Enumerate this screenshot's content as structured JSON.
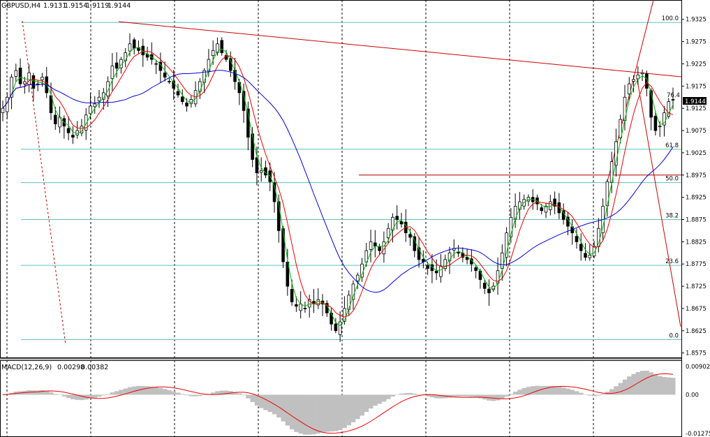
{
  "header": {
    "symbol": "GBPUSD,H4",
    "open": "1.9131",
    "high": "1.9154",
    "low": "1.9119",
    "close": "1.9144"
  },
  "macd_header": {
    "label": "MACD(12,26,9)",
    "main": "0.00298",
    "signal": "0.00382"
  },
  "price_axis": {
    "ticks": [
      "1.9325",
      "1.9275",
      "1.9225",
      "1.9175",
      "1.9125",
      "1.9075",
      "1.9025",
      "1.8975",
      "1.8925",
      "1.8875",
      "1.8825",
      "1.8775",
      "1.8725",
      "1.8675",
      "1.8625",
      "1.8575"
    ],
    "current_price": "1.9144",
    "range": [
      1.8565,
      1.9345
    ]
  },
  "macd_axis": {
    "ticks": [
      "0.00902",
      "0.00",
      "-0.01275"
    ],
    "range": [
      -0.0133,
      0.0106
    ]
  },
  "fibonacci": {
    "levels": [
      {
        "label": "100.0",
        "price": 1.9318
      },
      {
        "label": "61.8",
        "price": 1.9033
      },
      {
        "label": "50.0",
        "price": 1.8958
      },
      {
        "label": "38.2",
        "price": 1.8875
      },
      {
        "label": "23.6",
        "price": 1.8772
      },
      {
        "label": "0.0",
        "price": 1.8605
      }
    ],
    "line_color": "#5fbfbf"
  },
  "trend_marker": "76.4",
  "colors": {
    "background": "#ffffff",
    "bull_candle": "#ffffff",
    "bear_candle": "#000000",
    "ma_fast": "#00bb00",
    "ma_mid": "#ee0000",
    "ma_slow": "#0000dd",
    "trendline": "#cc0000",
    "fib": "#5fbfbf",
    "macd_hist": "#c0c0c0",
    "macd_signal": "#ee0000",
    "grid": "#000000"
  },
  "chart_data": {
    "type": "candlestick",
    "symbol": "GBPUSD",
    "timeframe": "H4",
    "close_series": [
      1.9125,
      1.915,
      1.9195,
      1.921,
      1.918,
      1.9185,
      1.9205,
      1.917,
      1.918,
      1.9195,
      1.916,
      1.9115,
      1.909,
      1.9105,
      1.9085,
      1.907,
      1.906,
      1.9075,
      1.9085,
      1.911,
      1.913,
      1.9135,
      1.915,
      1.916,
      1.9185,
      1.922,
      1.9215,
      1.9235,
      1.925,
      1.927,
      1.926,
      1.9255,
      1.9245,
      1.924,
      1.9235,
      1.9225,
      1.921,
      1.9195,
      1.9185,
      1.917,
      1.9155,
      1.914,
      1.913,
      1.9145,
      1.9165,
      1.9185,
      1.921,
      1.9235,
      1.9255,
      1.927,
      1.925,
      1.9235,
      1.921,
      1.9185,
      1.916,
      1.912,
      1.906,
      1.901,
      1.898,
      1.8985,
      1.8975,
      1.896,
      1.8915,
      1.885,
      1.878,
      1.8725,
      1.869,
      1.868,
      1.8685,
      1.8675,
      1.8695,
      1.8685,
      1.8695,
      1.8685,
      1.8665,
      1.864,
      1.8625,
      1.8645,
      1.8675,
      1.8705,
      1.873,
      1.875,
      1.8775,
      1.8805,
      1.8825,
      1.8815,
      1.8805,
      1.8825,
      1.8855,
      1.888,
      1.8875,
      1.8865,
      1.8845,
      1.8835,
      1.8805,
      1.8785,
      1.878,
      1.8765,
      1.876,
      1.8755,
      1.877,
      1.8785,
      1.88,
      1.881,
      1.88,
      1.879,
      1.8785,
      1.8775,
      1.876,
      1.874,
      1.872,
      1.871,
      1.8725,
      1.876,
      1.88,
      1.8845,
      1.888,
      1.8905,
      1.8915,
      1.892,
      1.8925,
      1.8915,
      1.891,
      1.8895,
      1.8905,
      1.8915,
      1.8905,
      1.889,
      1.8875,
      1.886,
      1.8845,
      1.8825,
      1.8805,
      1.879,
      1.8795,
      1.8815,
      1.8855,
      1.8905,
      1.896,
      1.9005,
      1.905,
      1.91,
      1.915,
      1.918,
      1.919,
      1.92,
      1.9205,
      1.917,
      1.9105,
      1.9075,
      1.9085,
      1.9115,
      1.914,
      1.9144
    ],
    "horizontal_resistance": 1.8975,
    "macd_hist_range": [
      -0.0128,
      0.009
    ]
  }
}
